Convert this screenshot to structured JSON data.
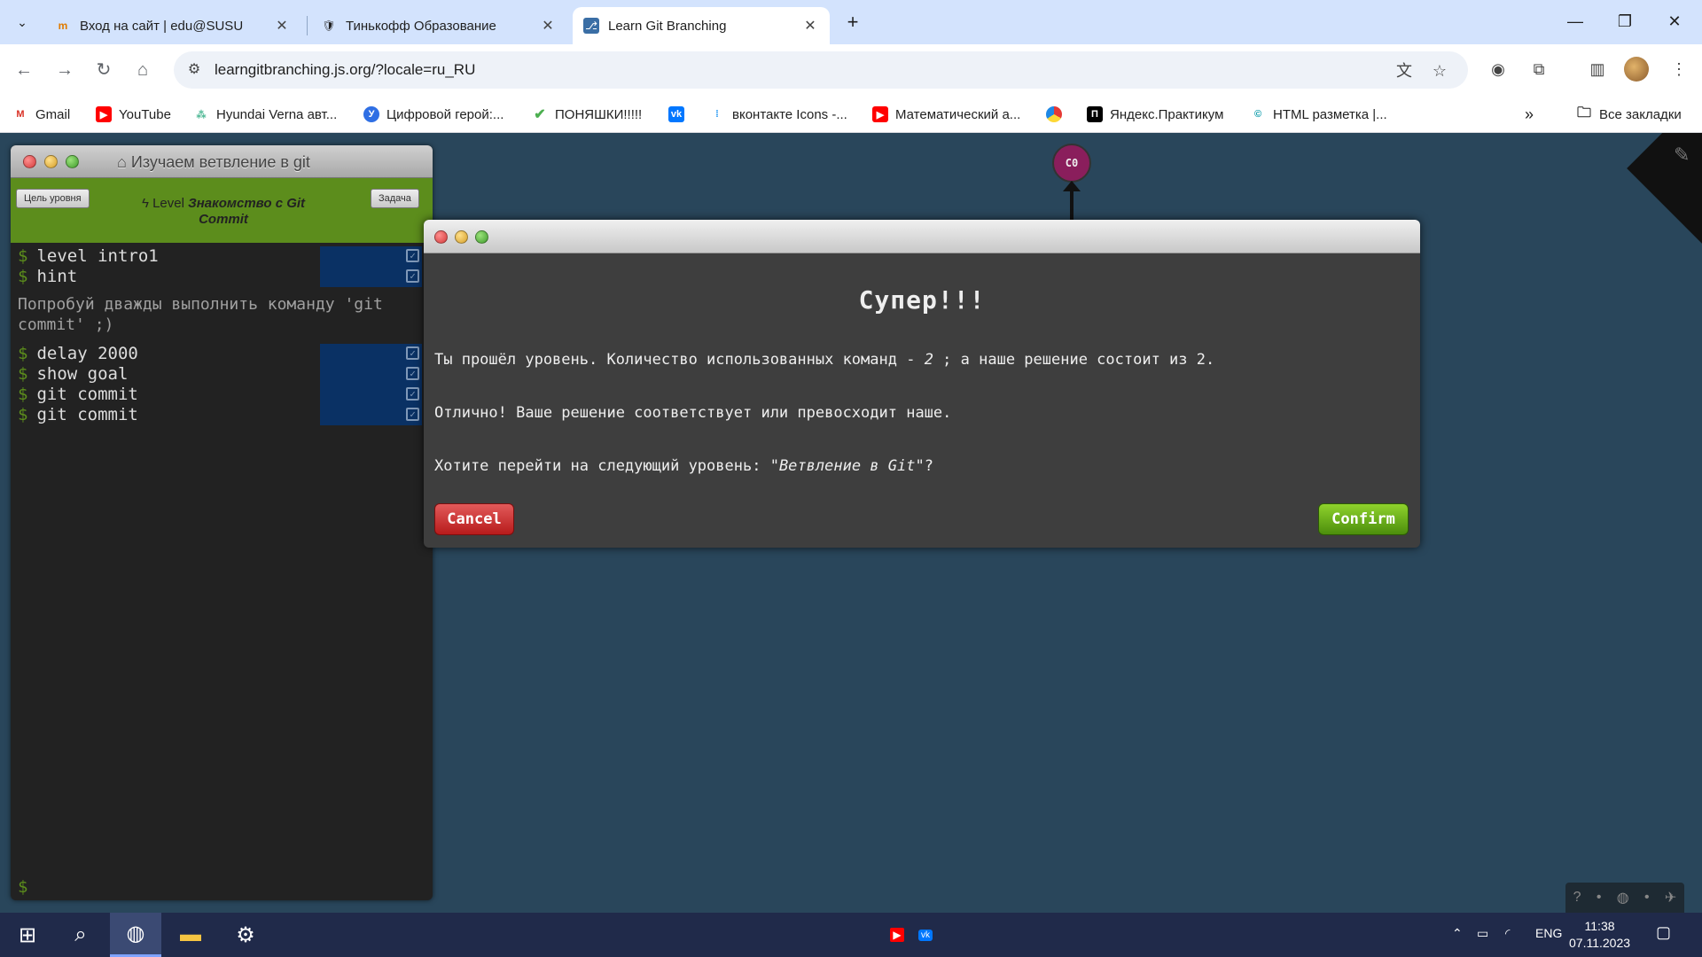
{
  "browser": {
    "tabs": [
      {
        "title": "Вход на сайт | edu@SUSU",
        "favicon": "susu-icon"
      },
      {
        "title": "Тинькофф Образование",
        "favicon": "tinkoff-icon"
      },
      {
        "title": "Learn Git Branching",
        "favicon": "git-branching-icon",
        "active": true
      }
    ],
    "url": "learngitbranching.js.org/?locale=ru_RU",
    "bookmarks": [
      {
        "label": "Gmail",
        "icon": "gmail-icon"
      },
      {
        "label": "YouTube",
        "icon": "youtube-icon"
      },
      {
        "label": "Hyundai Verna авт...",
        "icon": "dots-icon"
      },
      {
        "label": "Цифровой герой:...",
        "icon": "cyber-hero-icon"
      },
      {
        "label": "ПОНЯШКИ!!!!!",
        "icon": "check-icon"
      },
      {
        "label": "",
        "icon": "vk-icon"
      },
      {
        "label": "вконтакте Icons -...",
        "icon": "icons8-icon"
      },
      {
        "label": "Математический а...",
        "icon": "youtube-icon"
      },
      {
        "label": "",
        "icon": "circle-logo-icon"
      },
      {
        "label": "Яндекс.Практикум",
        "icon": "praktikum-icon"
      },
      {
        "label": "HTML разметка |...",
        "icon": "html-icon"
      }
    ],
    "all_bookmarks": "Все закладки"
  },
  "terminal": {
    "title": "Изучаем ветвление в git",
    "level_goal_btn": "Цель уровня",
    "level_prefix": "Level",
    "level_name": "Знакомство с Git Commit",
    "task_btn": "Задача",
    "commands_top": [
      "level intro1",
      "hint"
    ],
    "hint": "Попробуй дважды выполнить команду 'git commit' ;)",
    "commands_bottom": [
      "delay 2000",
      "show goal",
      "git commit",
      "git commit"
    ],
    "prompt": "$"
  },
  "tree": {
    "commit": "C0"
  },
  "modal": {
    "heading": "Супер!!!",
    "line1_a": "Ты прошёл уровень. Количество использованных команд - ",
    "line1_num": "2",
    "line1_b": " ; а наше решение состоит из 2.",
    "line2": "Отлично! Ваше решение соответствует или превосходит наше.",
    "line3_a": "Хотите перейти на следующий уровень: ",
    "line3_level": "\"Ветвление в Git\"",
    "line3_b": "?",
    "cancel": "Cancel",
    "confirm": "Confirm"
  },
  "taskbar": {
    "lang": "ENG",
    "time": "11:38",
    "date": "07.11.2023"
  }
}
